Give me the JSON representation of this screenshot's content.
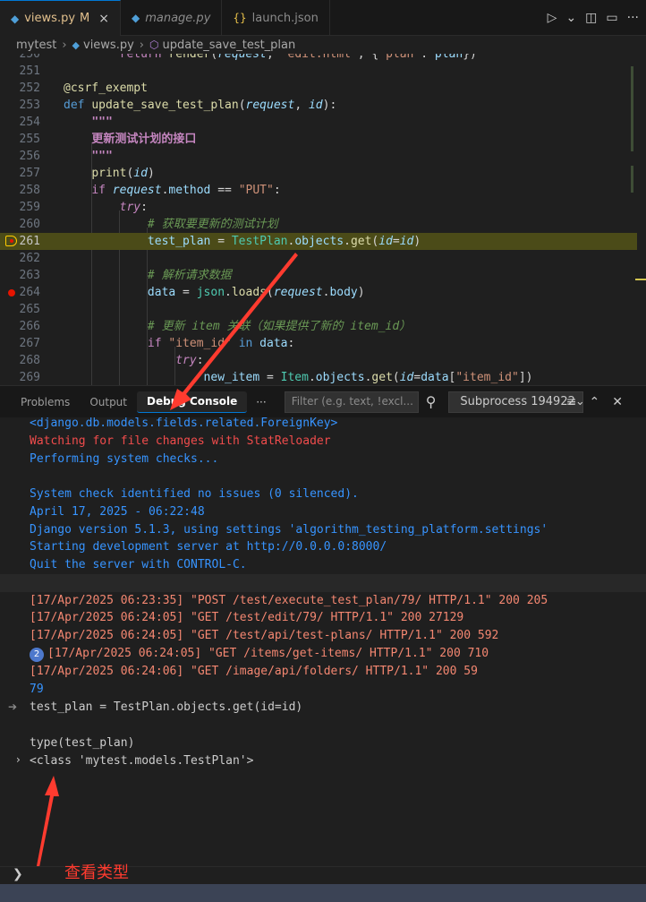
{
  "tabs": [
    {
      "icon": "python-file-icon",
      "label": "views.py",
      "modified": "M",
      "close": "×",
      "active": true
    },
    {
      "icon": "python-file-icon",
      "label": "manage.py",
      "active": false
    },
    {
      "icon": "json-file-icon",
      "label": "launch.json",
      "active": false
    }
  ],
  "tab_actions": [
    "run-debug-icon",
    "chevron-down-icon",
    "split-editor-icon",
    "layout-icon",
    "more-icon"
  ],
  "breadcrumb": [
    "mytest",
    "views.py",
    "update_save_test_plan"
  ],
  "editor": {
    "lines": [
      {
        "n": "250",
        "code": "        return render(request, 'edit.html', {'plan': plan})"
      },
      {
        "n": "251",
        "code": ""
      },
      {
        "n": "252",
        "code": "@csrf_exempt"
      },
      {
        "n": "253",
        "code": "def update_save_test_plan(request, id):"
      },
      {
        "n": "254",
        "code": "    \"\"\""
      },
      {
        "n": "255",
        "code": "    更新测试计划的接口"
      },
      {
        "n": "256",
        "code": "    \"\"\""
      },
      {
        "n": "257",
        "code": "    print(id)"
      },
      {
        "n": "258",
        "code": "    if request.method == \"PUT\":"
      },
      {
        "n": "259",
        "code": "        try:"
      },
      {
        "n": "260",
        "code": "            # 获取要更新的测试计划"
      },
      {
        "n": "261",
        "code": "            test_plan = TestPlan.objects.get(id=id)"
      },
      {
        "n": "262",
        "code": ""
      },
      {
        "n": "263",
        "code": "            # 解析请求数据"
      },
      {
        "n": "264",
        "code": "            data = json.loads(request.body)"
      },
      {
        "n": "265",
        "code": ""
      },
      {
        "n": "266",
        "code": "            # 更新 item 关联（如果提供了新的 item_id）"
      },
      {
        "n": "267",
        "code": "            if \"item_id\" in data:"
      },
      {
        "n": "268",
        "code": "                try:"
      },
      {
        "n": "269",
        "code": "                    new_item = Item.objects.get(id=data[\"item_id\"])"
      }
    ]
  },
  "panel": {
    "tabs": [
      "Problems",
      "Output",
      "Debug Console"
    ],
    "more": "···",
    "filter_placeholder": "Filter (e.g. text, !excl...",
    "subprocess": "Subprocess 194922",
    "actions": [
      "clear-console-icon",
      "chevron-up-icon",
      "close-icon"
    ]
  },
  "console": {
    "head": "<django.db.models.fields.related.ForeignKey>",
    "reloader": "Watching for file changes with StatReloader",
    "checks": "Performing system checks...",
    "info": [
      "System check identified no issues (0 silenced).",
      "April 17, 2025 - 06:22:48",
      "Django version 5.1.3, using settings 'algorithm_testing_platform.settings'",
      "Starting development server at http://0.0.0.0:8000/",
      "Quit the server with CONTROL-C."
    ],
    "requests": [
      "[17/Apr/2025 06:23:35] \"POST /test/execute_test_plan/79/ HTTP/1.1\" 200 205",
      "[17/Apr/2025 06:24:05] \"GET /test/edit/79/ HTTP/1.1\" 200 27129",
      "[17/Apr/2025 06:24:05] \"GET /test/api/test-plans/ HTTP/1.1\" 200 592",
      "[17/Apr/2025 06:24:05] \"GET /items/get-items/ HTTP/1.1\" 200 710",
      "[17/Apr/2025 06:24:06] \"GET /image/api/folders/ HTTP/1.1\" 200 59"
    ],
    "repeat_badge": "2",
    "id_value": "79",
    "eval1": "test_plan = TestPlan.objects.get(id=id)",
    "eval2": "type(test_plan)",
    "result": "<class 'mytest.models.TestPlan'>",
    "prompt": "❯"
  },
  "annotation": "查看类型",
  "colors": {
    "accent": "#0078d4",
    "annotation": "#ff3b2f",
    "highlight": "#4b4b18"
  }
}
